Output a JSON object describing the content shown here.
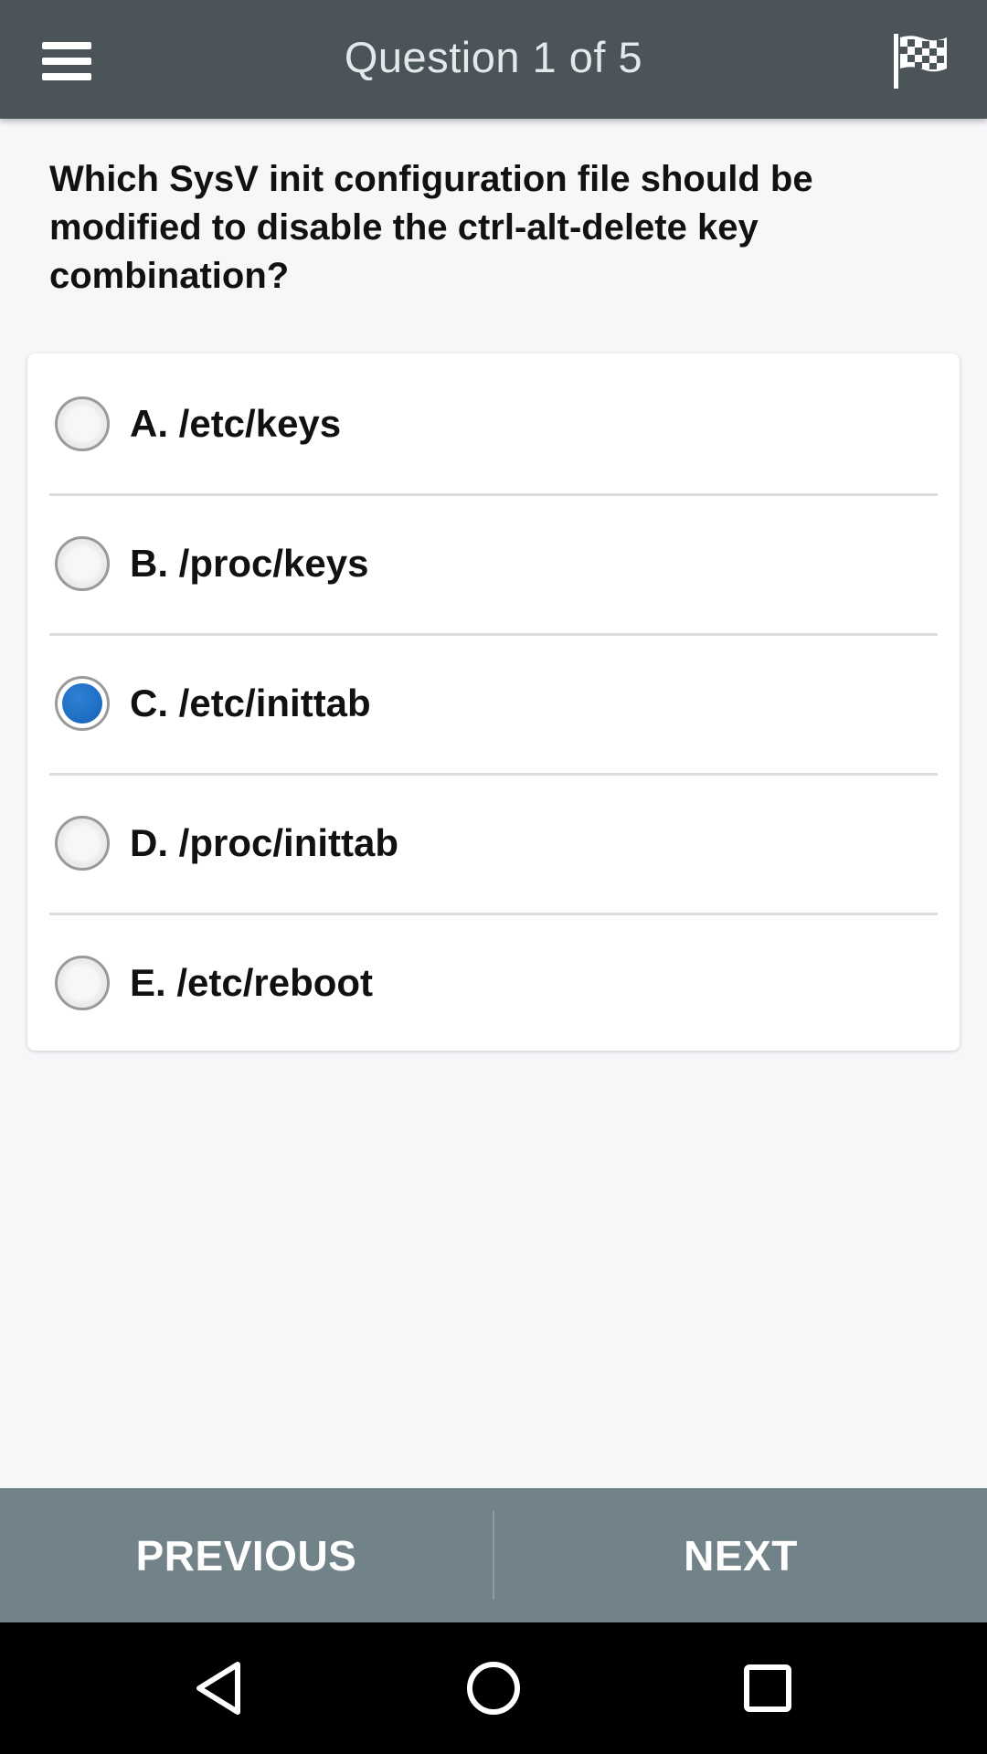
{
  "app_bar": {
    "title": "Question 1 of 5",
    "menu_icon": "hamburger-menu-icon",
    "flag_icon": "checkered-flag-icon",
    "background_color": "#4a5459"
  },
  "question": {
    "text": "Which SysV init configuration file should be modified to disable the ctrl-alt-delete key combination?"
  },
  "options": [
    {
      "label": "A. /etc/keys",
      "selected": false
    },
    {
      "label": "B. /proc/keys",
      "selected": false
    },
    {
      "label": "C. /etc/inittab",
      "selected": true
    },
    {
      "label": "D. /proc/inittab",
      "selected": false
    },
    {
      "label": "E. /etc/reboot",
      "selected": false
    }
  ],
  "navigation": {
    "previous_label": "PREVIOUS",
    "next_label": "NEXT",
    "background_color": "#728289"
  },
  "system_nav": {
    "back_icon": "back-triangle-icon",
    "home_icon": "home-circle-icon",
    "recents_icon": "recents-square-icon"
  },
  "colors": {
    "accent": "#1f6fc4",
    "page_background": "#f7f6f9"
  }
}
